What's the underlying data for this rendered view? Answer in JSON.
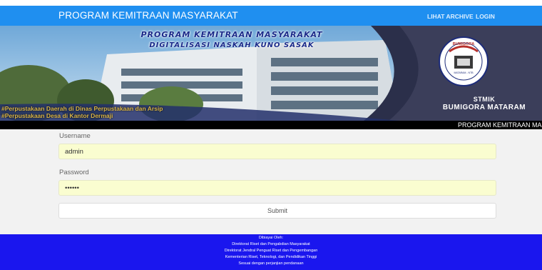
{
  "navbar": {
    "brand": "PROGRAM KEMITRAAN MASYARAKAT",
    "links": [
      "LIHAT ARCHIVE",
      "LOGIN"
    ]
  },
  "banner": {
    "title_line1": "PROGRAM KEMITRAAN MASYARAKAT",
    "title_line2": "DIGITALISASI NASKAH KUNO SASAK",
    "scroll_line1": "#Perpustakaan Daerah di Dinas Perpustakaan dan Arsip",
    "scroll_line2": "#Perpustakaan Desa di Kantor Dermaji",
    "logo_text": "BUMIGORA",
    "logo_sub": "MATARAM - NTB",
    "institution_line1": "STMIK",
    "institution_line2": "BUMIGORA MATARAM"
  },
  "marquee": {
    "text": "PROGRAM KEMITRAAN MASY"
  },
  "form": {
    "username_label": "Username",
    "username_value": "admin",
    "password_label": "Password",
    "password_value": "••••••",
    "submit_label": "Submit"
  },
  "footer": {
    "line1": "Dibiayai Oleh:",
    "line2": "Direktorat Riset dan Pengabdian Masyarakat",
    "line3": "Direktorat Jendral Penguat Riset dan Pengembangan",
    "line4": "Kementerian Riset, Teknologi, dan Pendidikan Tinggi",
    "line5": "Sesuai dengan perjanjian pendanaan"
  },
  "colors": {
    "navbar": "#1f8ff0",
    "footer": "#1a16ee",
    "input_bg": "#fafdd0"
  }
}
